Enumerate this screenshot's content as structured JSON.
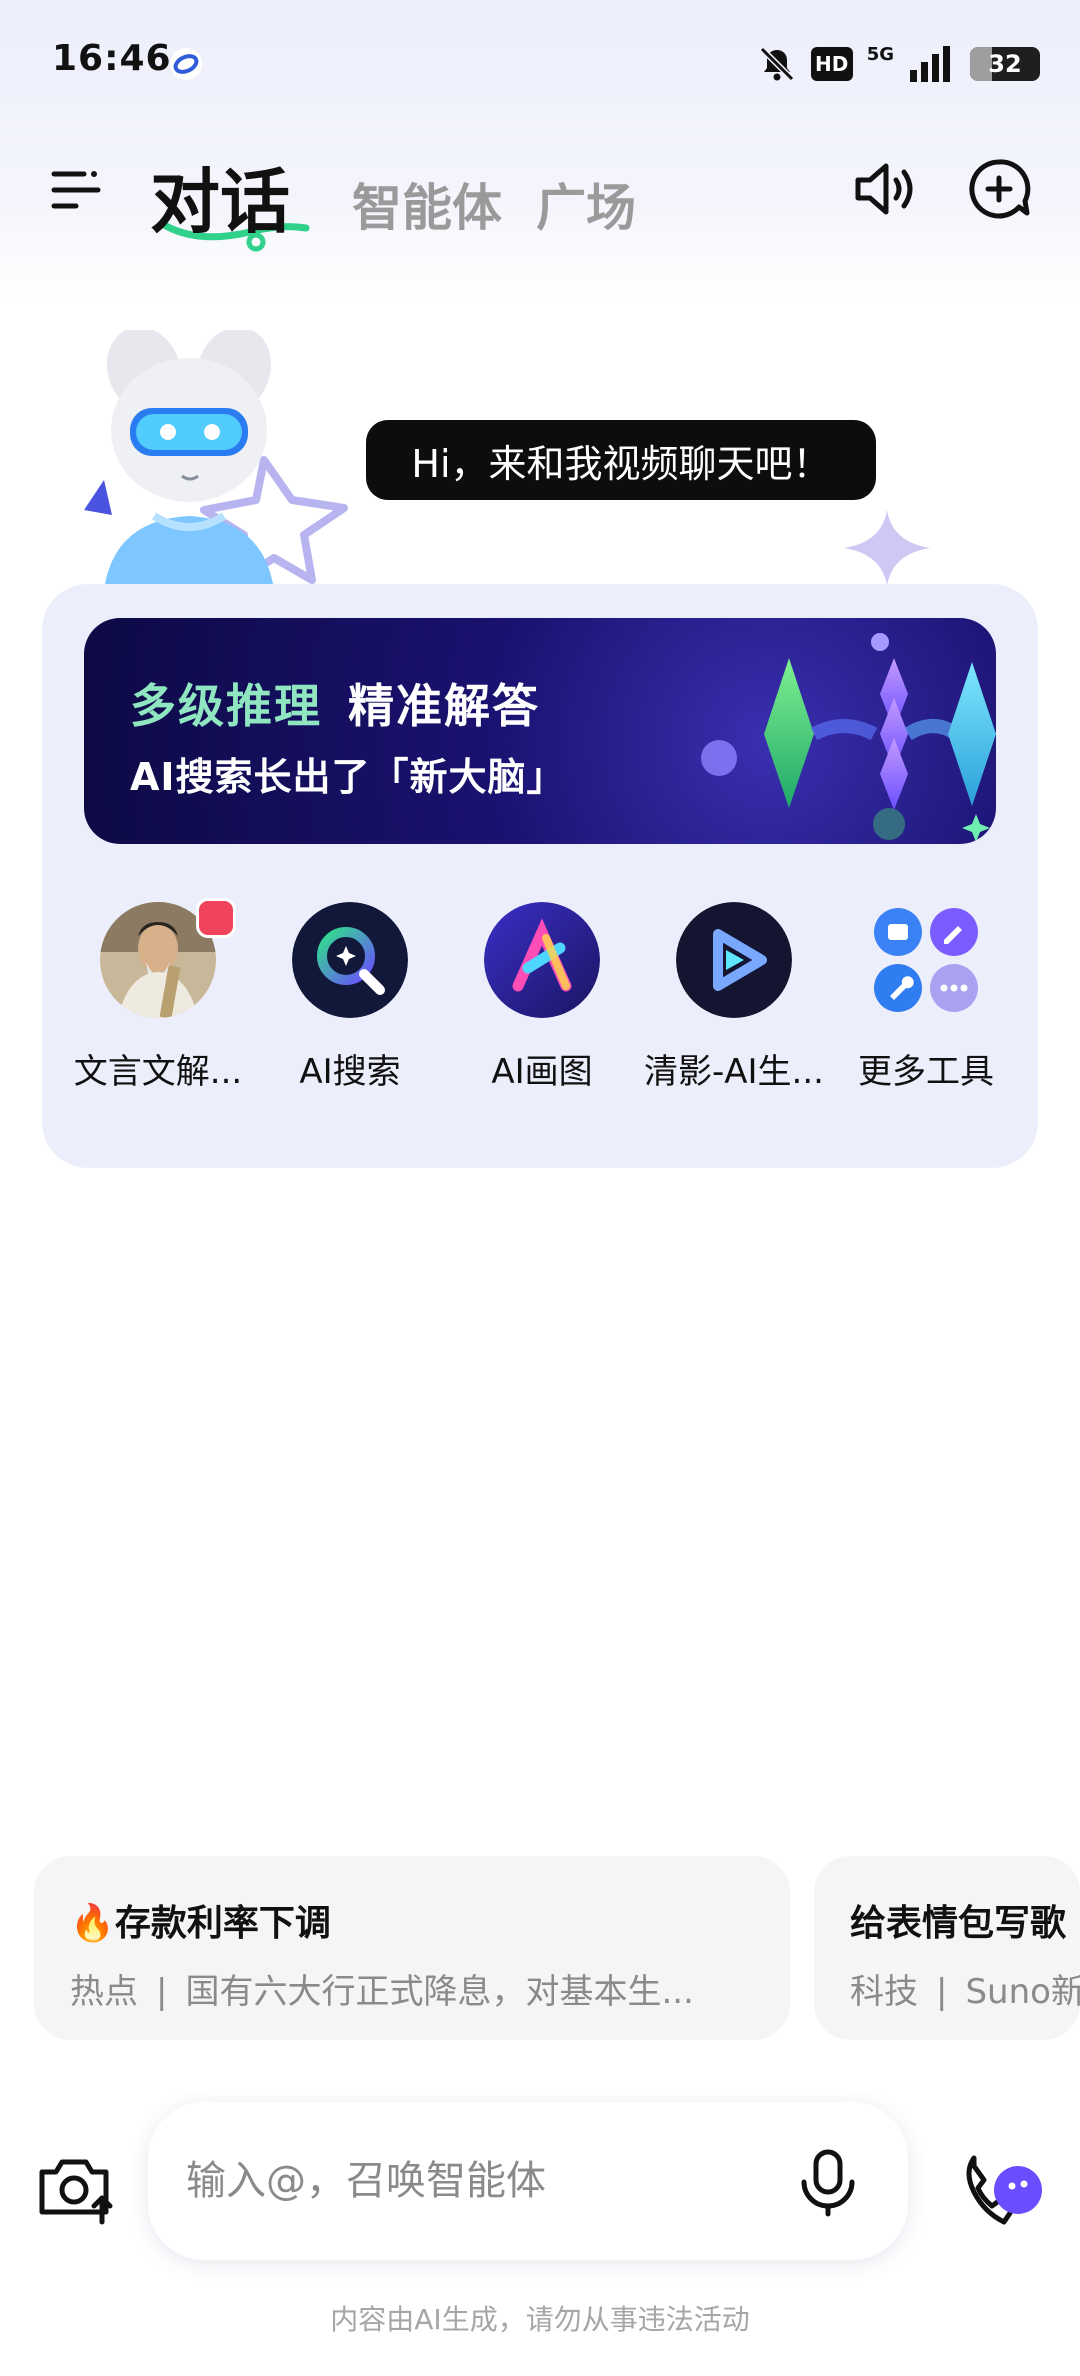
{
  "status_bar": {
    "time": "16:46",
    "hd": "HD",
    "network": "5G",
    "battery": "32",
    "battery_level": 0.32
  },
  "nav": {
    "tabs": [
      {
        "label": "对话",
        "active": true
      },
      {
        "label": "智能体",
        "active": false
      },
      {
        "label": "广场",
        "active": false
      }
    ]
  },
  "hero": {
    "greeting": "Hi，来和我视频聊天吧！"
  },
  "banner": {
    "title_part1": "多级推理",
    "title_part2": "精准解答",
    "subtitle": "AI搜索长出了「新大脑」"
  },
  "tools": [
    {
      "label": "文言文解...",
      "icon": "scholar-portrait-icon",
      "hot": true
    },
    {
      "label": "AI搜索",
      "icon": "ai-search-icon"
    },
    {
      "label": "AI画图",
      "icon": "ai-drawing-icon"
    },
    {
      "label": "清影-AI生...",
      "icon": "video-play-icon"
    },
    {
      "label": "更多工具",
      "icon": "more-tools-icon"
    }
  ],
  "trending": [
    {
      "emoji": "🔥",
      "title": "存款利率下调",
      "tag": "热点",
      "summary": "国有六大行正式降息，对基本生..."
    },
    {
      "title": "给表情包写歌",
      "tag": "科技",
      "summary": "Suno新"
    }
  ],
  "input": {
    "placeholder": "输入@，召唤智能体"
  },
  "footer": {
    "disclaimer": "内容由AI生成，请勿从事违法活动"
  },
  "colors": {
    "accent_green": "#2fd18b",
    "banner_green_text": "#8fe6c0",
    "voice_purple": "#6b4dff",
    "hot_badge": "#f0435c"
  }
}
